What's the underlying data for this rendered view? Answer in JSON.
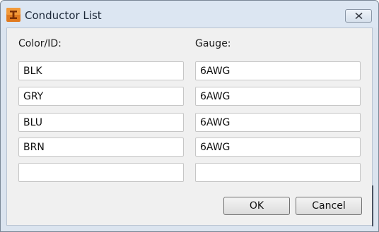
{
  "window": {
    "title": "Conductor List",
    "app_icon": "app-i-icon",
    "close_icon": "close-icon"
  },
  "labels": {
    "color_id": "Color/ID:",
    "gauge": "Gauge:"
  },
  "rows": [
    {
      "color_id": "BLK",
      "gauge": "6AWG"
    },
    {
      "color_id": "GRY",
      "gauge": "6AWG"
    },
    {
      "color_id": "BLU",
      "gauge": "6AWG"
    },
    {
      "color_id": "BRN",
      "gauge": "6AWG"
    },
    {
      "color_id": "",
      "gauge": ""
    }
  ],
  "buttons": {
    "ok": "OK",
    "cancel": "Cancel"
  }
}
